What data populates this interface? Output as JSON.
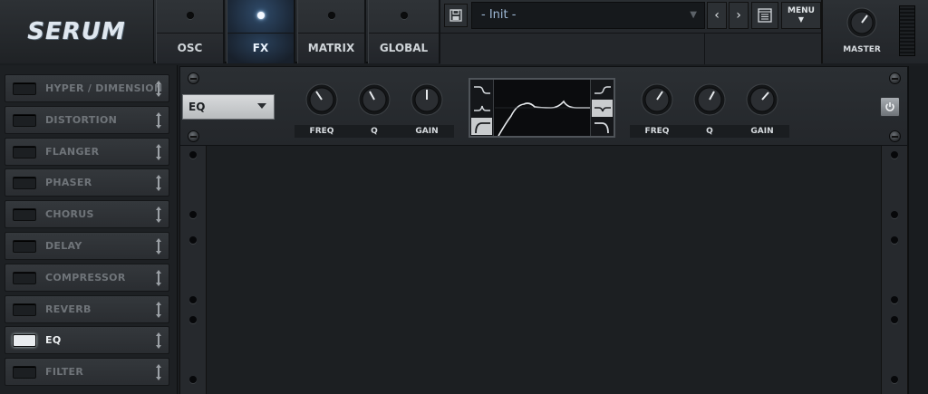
{
  "app": {
    "logo": "SERUM"
  },
  "tabs": [
    {
      "label": "OSC",
      "active": false
    },
    {
      "label": "FX",
      "active": true
    },
    {
      "label": "MATRIX",
      "active": false
    },
    {
      "label": "GLOBAL",
      "active": false
    }
  ],
  "preset": {
    "name": "- Init -",
    "menu_label": "MENU"
  },
  "master": {
    "label": "MASTER"
  },
  "fx_rack": {
    "items": [
      {
        "label": "HYPER / DIMENSION",
        "enabled": false
      },
      {
        "label": "DISTORTION",
        "enabled": false
      },
      {
        "label": "FLANGER",
        "enabled": false
      },
      {
        "label": "PHASER",
        "enabled": false
      },
      {
        "label": "CHORUS",
        "enabled": false
      },
      {
        "label": "DELAY",
        "enabled": false
      },
      {
        "label": "COMPRESSOR",
        "enabled": false
      },
      {
        "label": "REVERB",
        "enabled": false
      },
      {
        "label": "EQ",
        "enabled": true
      },
      {
        "label": "FILTER",
        "enabled": false
      }
    ]
  },
  "eq": {
    "selected_module": "EQ",
    "band1": {
      "freq_label": "FREQ",
      "q_label": "Q",
      "gain_label": "GAIN"
    },
    "band2": {
      "freq_label": "FREQ",
      "q_label": "Q",
      "gain_label": "GAIN"
    },
    "colors": {
      "accent": "#9fd1ff",
      "panel": "#202326"
    }
  }
}
